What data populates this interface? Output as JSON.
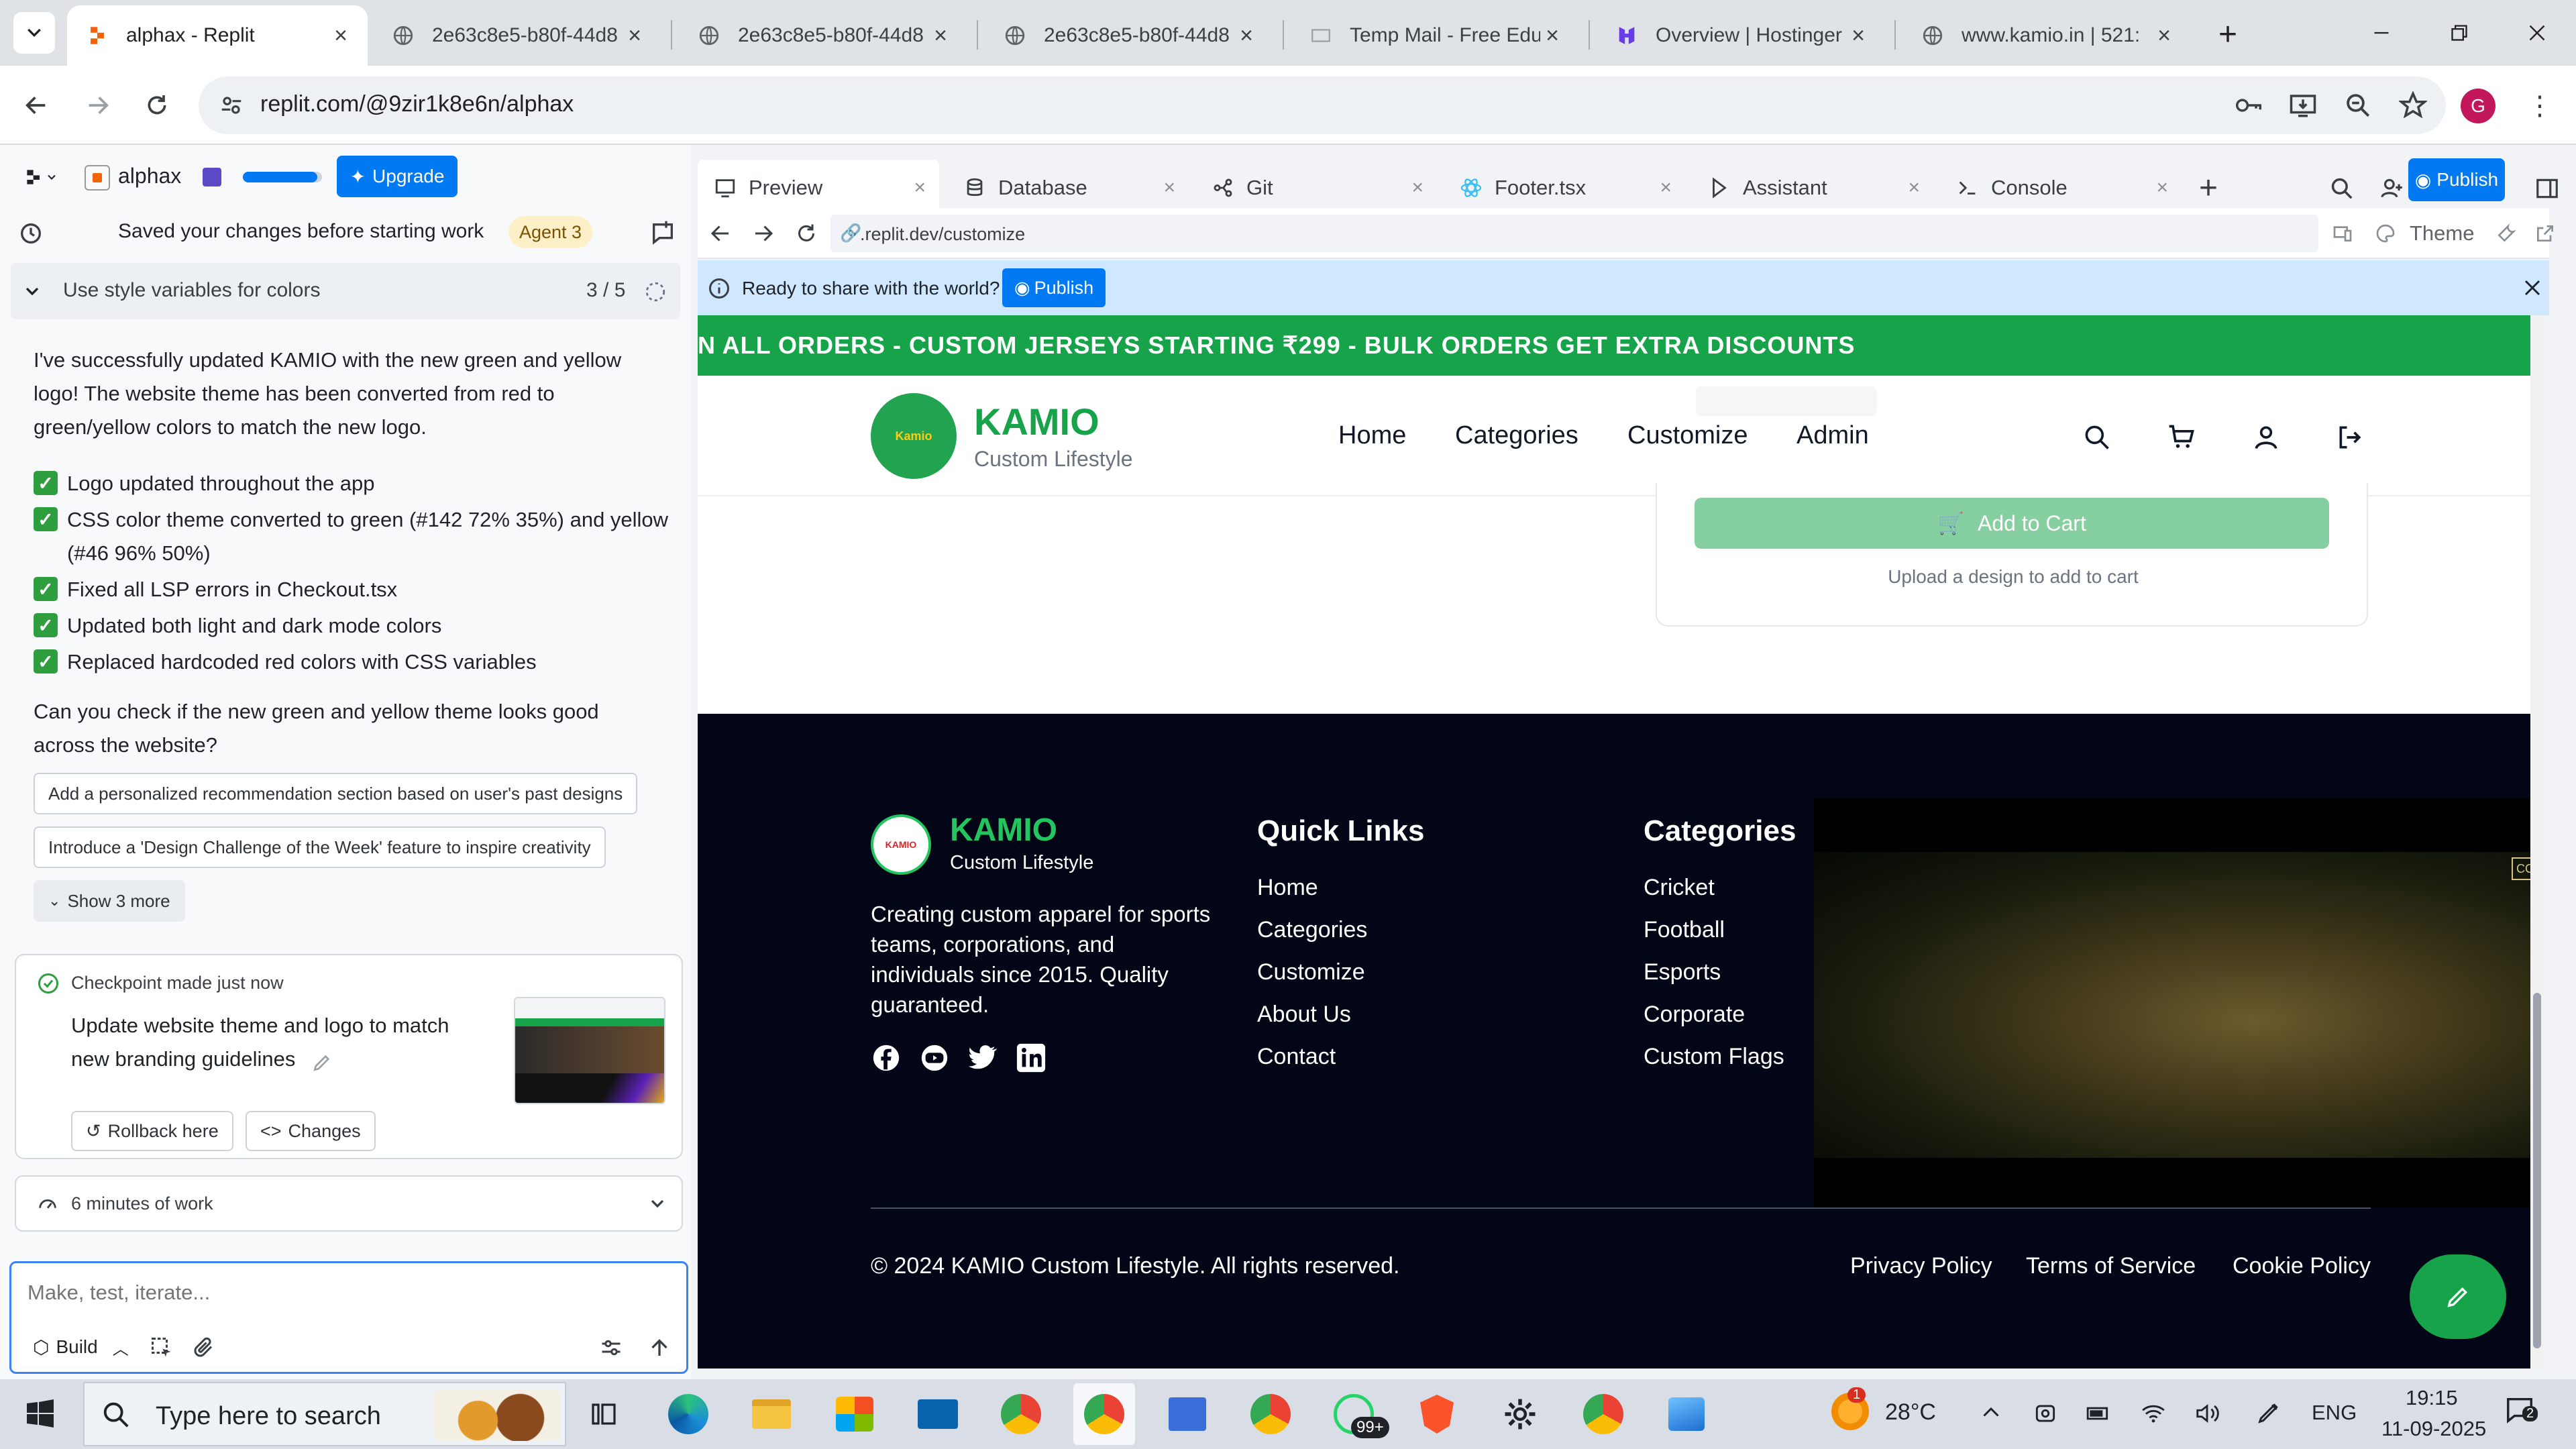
{
  "browser": {
    "tabs": [
      {
        "title": "alphax - Replit",
        "active": true
      },
      {
        "title": "2e63c8e5-b80f-44d8",
        "active": false
      },
      {
        "title": "2e63c8e5-b80f-44d8",
        "active": false
      },
      {
        "title": "2e63c8e5-b80f-44d8",
        "active": false
      },
      {
        "title": "Temp Mail - Free Edu",
        "active": false
      },
      {
        "title": "Overview | Hostinger",
        "active": false
      },
      {
        "title": "www.kamio.in | 521:",
        "active": false
      }
    ],
    "url": "replit.com/@9zir1k8e6n/alphax",
    "profile_initial": "G"
  },
  "replit": {
    "project_name": "alphax",
    "upgrade_label": "Upgrade",
    "status_text": "Saved your changes before starting work",
    "agent_badge": "Agent 3",
    "task_title": "Use style variables for colors",
    "task_progress": "3 / 5",
    "message_intro": "I've successfully updated KAMIO with the new green and yellow logo! The website theme has been converted from red to green/yellow colors to match the new logo.",
    "checklist": [
      "Logo updated throughout the app",
      "CSS color theme converted to green (#142 72% 35%) and yellow (#46 96% 50%)",
      "Fixed all LSP errors in Checkout.tsx",
      "Updated both light and dark mode colors",
      "Replaced hardcoded red colors with CSS variables"
    ],
    "question": "Can you check if the new green and yellow theme looks good across the website?",
    "suggestions": [
      "Add a personalized recommendation section based on user's past designs",
      "Introduce a 'Design Challenge of the Week' feature to inspire creativity"
    ],
    "show_more": "Show 3 more",
    "checkpoint": {
      "header": "Checkpoint made just now",
      "description": "Update website theme and logo to match new branding guidelines",
      "rollback": "Rollback here",
      "changes": "Changes"
    },
    "work_time": "6 minutes of work",
    "input_placeholder": "Make, test, iterate...",
    "build_label": "Build"
  },
  "workspace": {
    "tabs": [
      "Preview",
      "Database",
      "Git",
      "Footer.tsx",
      "Assistant",
      "Console"
    ],
    "publish_label": "Publish",
    "preview_url": ".replit.dev/customize",
    "theme_label": "Theme",
    "banner_text": "Ready to share with the world?",
    "banner_publish": "Publish"
  },
  "site": {
    "marquee": "N ALL ORDERS - CUSTOM JERSEYS STARTING ₹299 - BULK ORDERS GET EXTRA DISCOUNTS",
    "brand": "KAMIO",
    "tagline": "Custom Lifestyle",
    "logo_text": "Kamio",
    "nav": [
      "Home",
      "Categories",
      "Customize",
      "Admin"
    ],
    "add_to_cart": "Add to Cart",
    "upload_hint": "Upload a design to add to cart",
    "footer": {
      "brand": "KAMIO",
      "tagline": "Custom Lifestyle",
      "logo_text": "KAMIO",
      "description": "Creating custom apparel for sports teams, corporations, and individuals since 2015. Quality guaranteed.",
      "quick_links_title": "Quick Links",
      "quick_links": [
        "Home",
        "Categories",
        "Customize",
        "About Us",
        "Contact"
      ],
      "categories_title": "Categories",
      "categories": [
        "Cricket",
        "Football",
        "Esports",
        "Corporate",
        "Custom Flags"
      ],
      "copyright": "© 2024 KAMIO Custom Lifestyle. All rights reserved.",
      "legal": [
        "Privacy Policy",
        "Terms of Service",
        "Cookie Policy"
      ]
    }
  },
  "taskbar": {
    "search_placeholder": "Type here to search",
    "whatsapp_badge": "99+",
    "weather_temp": "28°C",
    "weather_alert": "1",
    "language": "ENG",
    "time": "19:15",
    "date": "11-09-2025",
    "notification_count": "2"
  },
  "colors": {
    "replit_blue": "#0079f2",
    "brand_green": "#16a34a",
    "footer_bg": "#020617",
    "banner_bg": "#cfe7ff"
  }
}
